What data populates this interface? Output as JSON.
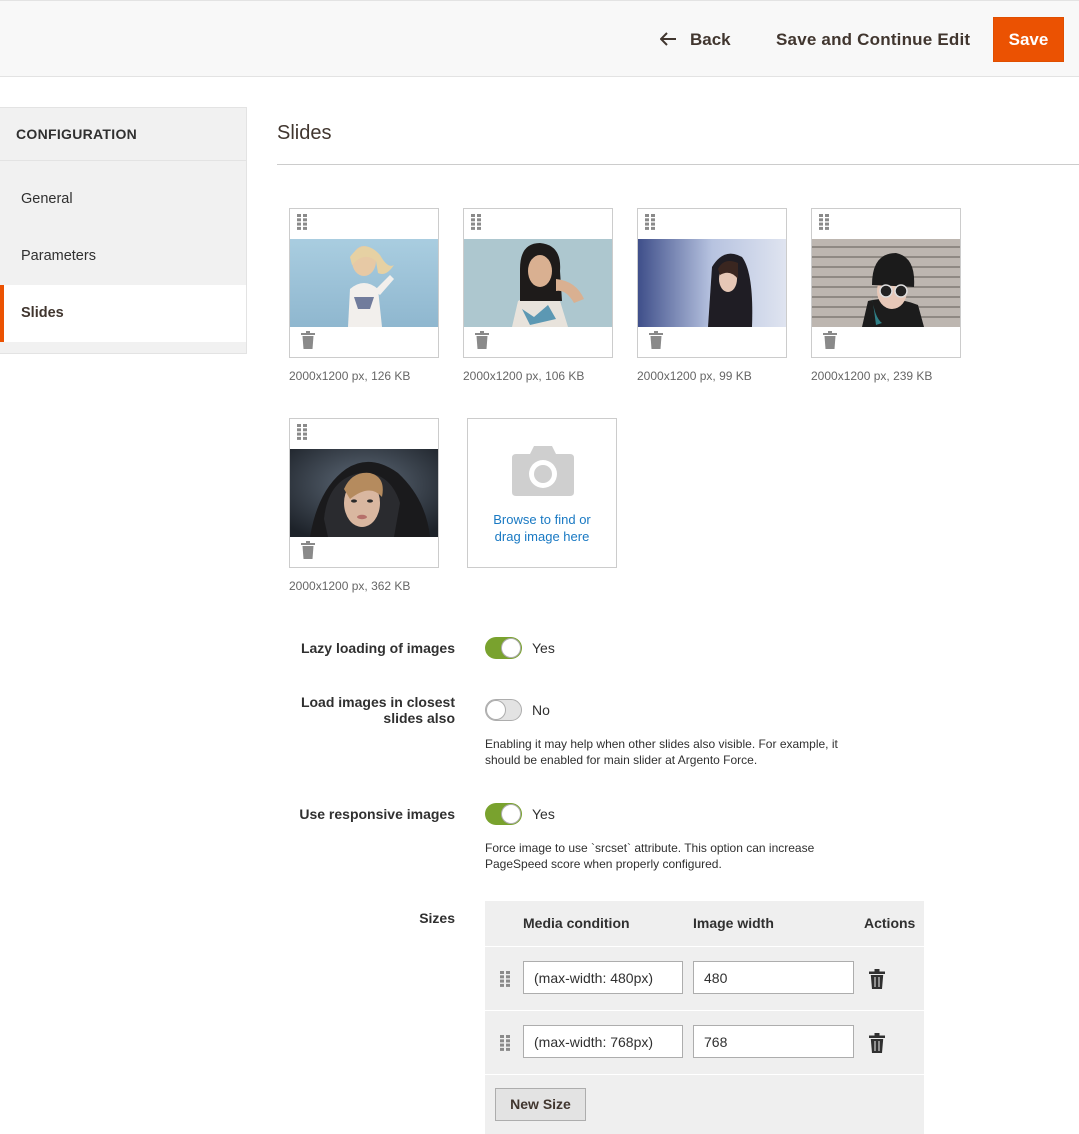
{
  "header": {
    "back_label": "Back",
    "save_continue_label": "Save and Continue Edit",
    "save_label": "Save",
    "accent": "#eb5202"
  },
  "sidebar": {
    "title": "CONFIGURATION",
    "items": [
      {
        "label": "General",
        "active": false
      },
      {
        "label": "Parameters",
        "active": false
      },
      {
        "label": "Slides",
        "active": true
      }
    ]
  },
  "slides": {
    "title": "Slides",
    "images": [
      {
        "meta": "2000x1200 px, 126 KB"
      },
      {
        "meta": "2000x1200 px, 106 KB"
      },
      {
        "meta": "2000x1200 px, 99 KB"
      },
      {
        "meta": "2000x1200 px, 239 KB"
      },
      {
        "meta": "2000x1200 px, 362 KB"
      }
    ],
    "upload_line1": "Browse to find or",
    "upload_line2": "drag image here"
  },
  "form": {
    "lazy": {
      "label": "Lazy loading of images",
      "value": "Yes",
      "on": true
    },
    "closest": {
      "label_line1": "Load images in closest",
      "label_line2": "slides also",
      "value": "No",
      "on": false,
      "note_line1": "Enabling it may help when other slides also visible. For example, it",
      "note_line2": "should be enabled for main slider at Argento Force."
    },
    "responsive": {
      "label": "Use responsive images",
      "value": "Yes",
      "on": true,
      "note_line1": "Force image to use `srcset` attribute. This option can increase",
      "note_line2": "PageSpeed score when properly configured."
    },
    "sizes": {
      "label": "Sizes",
      "columns": [
        "Media condition",
        "Image width",
        "Actions"
      ],
      "rows": [
        {
          "media": "(max-width: 480px)",
          "width": "480"
        },
        {
          "media": "(max-width: 768px)",
          "width": "768"
        }
      ],
      "new_label": "New Size"
    }
  }
}
